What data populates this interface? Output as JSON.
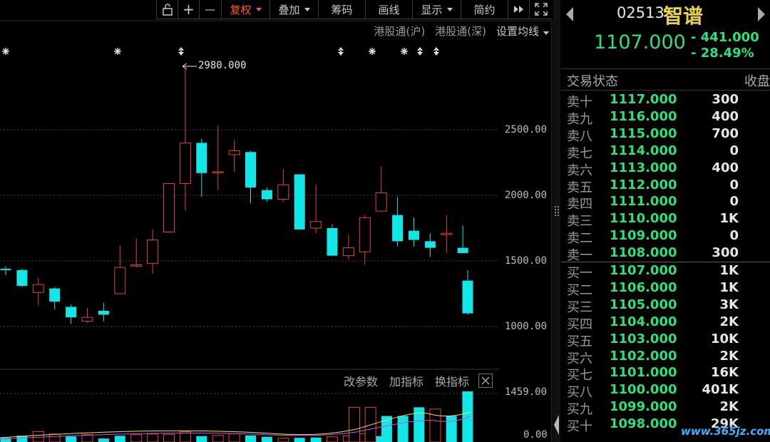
{
  "toolbar": {
    "lock_icon": "lock-icon",
    "plus": "+",
    "minus": "—",
    "fuquan": "复权",
    "diejia": "叠加",
    "chouma": "筹码",
    "huaxian": "画线",
    "xianshi": "显示",
    "jianyue": "简约"
  },
  "subbar": {
    "hk_sh": "港股通(沪)",
    "hk_sz": "港股通(深)",
    "ma_setting": "设置均线"
  },
  "chart": {
    "high_label": "2980.000",
    "y_labels": [
      "2500.00",
      "2000.00",
      "1500.00",
      "1000.00"
    ],
    "vol_labels": [
      "1459.00",
      "0.00"
    ],
    "bottom_buttons": {
      "params": "改参数",
      "add": "加指标",
      "switch": "换指标"
    },
    "up_color": "#e0453a",
    "down_color": "#12e6e6"
  },
  "chart_data": {
    "type": "candlestick",
    "y_ticks": [
      2500,
      2000,
      1500,
      1000
    ],
    "max_marked": 2980,
    "candles": [
      {
        "o": 1440,
        "h": 1460,
        "l": 1390,
        "c": 1430
      },
      {
        "o": 1430,
        "h": 1440,
        "l": 1300,
        "c": 1310
      },
      {
        "o": 1260,
        "h": 1370,
        "l": 1160,
        "c": 1320
      },
      {
        "o": 1290,
        "h": 1300,
        "l": 1130,
        "c": 1190
      },
      {
        "o": 1150,
        "h": 1170,
        "l": 1020,
        "c": 1070
      },
      {
        "o": 1040,
        "h": 1140,
        "l": 1030,
        "c": 1070
      },
      {
        "o": 1120,
        "h": 1180,
        "l": 1040,
        "c": 1090
      },
      {
        "o": 1250,
        "h": 1620,
        "l": 1250,
        "c": 1450
      },
      {
        "o": 1460,
        "h": 1670,
        "l": 1450,
        "c": 1470
      },
      {
        "o": 1480,
        "h": 1740,
        "l": 1400,
        "c": 1660
      },
      {
        "o": 1720,
        "h": 2080,
        "l": 1720,
        "c": 2090
      },
      {
        "o": 2090,
        "h": 2980,
        "l": 1880,
        "c": 2400
      },
      {
        "o": 2400,
        "h": 2430,
        "l": 1990,
        "c": 2170
      },
      {
        "o": 2180,
        "h": 2530,
        "l": 2040,
        "c": 2180
      },
      {
        "o": 2310,
        "h": 2420,
        "l": 2180,
        "c": 2340
      },
      {
        "o": 2330,
        "h": 2340,
        "l": 1940,
        "c": 2060
      },
      {
        "o": 2040,
        "h": 2060,
        "l": 1950,
        "c": 1970
      },
      {
        "o": 1970,
        "h": 2200,
        "l": 1950,
        "c": 2080
      },
      {
        "o": 2160,
        "h": 2160,
        "l": 1740,
        "c": 1740
      },
      {
        "o": 1750,
        "h": 2080,
        "l": 1710,
        "c": 1800
      },
      {
        "o": 1750,
        "h": 1780,
        "l": 1540,
        "c": 1540
      },
      {
        "o": 1540,
        "h": 1700,
        "l": 1510,
        "c": 1600
      },
      {
        "o": 1570,
        "h": 1850,
        "l": 1470,
        "c": 1830
      },
      {
        "o": 1880,
        "h": 2220,
        "l": 1880,
        "c": 2020
      },
      {
        "o": 1850,
        "h": 1990,
        "l": 1610,
        "c": 1650
      },
      {
        "o": 1730,
        "h": 1830,
        "l": 1610,
        "c": 1660
      },
      {
        "o": 1650,
        "h": 1710,
        "l": 1530,
        "c": 1600
      },
      {
        "o": 1700,
        "h": 1850,
        "l": 1560,
        "c": 1710
      },
      {
        "o": 1600,
        "h": 1770,
        "l": 1560,
        "c": 1560
      },
      {
        "o": 1350,
        "h": 1430,
        "l": 1090,
        "c": 1100
      }
    ],
    "volumes": [
      120,
      180,
      300,
      230,
      160,
      220,
      100,
      180,
      210,
      230,
      220,
      300,
      170,
      190,
      240,
      190,
      150,
      110,
      120,
      130,
      150,
      180,
      240,
      170,
      1000,
      1000,
      750,
      750,
      1000,
      950,
      750,
      1459
    ],
    "volume_colors": [
      "d",
      "d",
      "u",
      "u",
      "d",
      "u",
      "d",
      "d",
      "u",
      "u",
      "u",
      "u",
      "d",
      "u",
      "u",
      "d",
      "d",
      "u",
      "d",
      "d",
      "u",
      "u",
      "u",
      "d",
      "u",
      "u",
      "d",
      "d",
      "d",
      "u",
      "d",
      "d"
    ]
  },
  "panel": {
    "code": "02513",
    "name": "智谱",
    "price": "1107.000",
    "change": "- 441.000",
    "change_pct": "- 28.49%",
    "status_label": "交易状态",
    "status_right": "收盘"
  },
  "orderbook": {
    "asks": [
      {
        "label": "卖十",
        "price": "1117.000",
        "vol": "300"
      },
      {
        "label": "卖九",
        "price": "1116.000",
        "vol": "400"
      },
      {
        "label": "卖八",
        "price": "1115.000",
        "vol": "700"
      },
      {
        "label": "卖七",
        "price": "1114.000",
        "vol": "0"
      },
      {
        "label": "卖六",
        "price": "1113.000",
        "vol": "400"
      },
      {
        "label": "卖五",
        "price": "1112.000",
        "vol": "0"
      },
      {
        "label": "卖四",
        "price": "1111.000",
        "vol": "0"
      },
      {
        "label": "卖三",
        "price": "1110.000",
        "vol": "1K"
      },
      {
        "label": "卖二",
        "price": "1109.000",
        "vol": "0"
      },
      {
        "label": "卖一",
        "price": "1108.000",
        "vol": "300"
      }
    ],
    "bids": [
      {
        "label": "买一",
        "price": "1107.000",
        "vol": "1K"
      },
      {
        "label": "买二",
        "price": "1106.000",
        "vol": "1K"
      },
      {
        "label": "买三",
        "price": "1105.000",
        "vol": "3K"
      },
      {
        "label": "买四",
        "price": "1104.000",
        "vol": "2K"
      },
      {
        "label": "买五",
        "price": "1103.000",
        "vol": "10K"
      },
      {
        "label": "买六",
        "price": "1102.000",
        "vol": "2K"
      },
      {
        "label": "买七",
        "price": "1101.000",
        "vol": "16K"
      },
      {
        "label": "买八",
        "price": "1100.000",
        "vol": "401K"
      },
      {
        "label": "买九",
        "price": "1099.000",
        "vol": "2K"
      },
      {
        "label": "买十",
        "price": "1098.000",
        "vol": "29K"
      }
    ]
  },
  "watermark": "www.365jz.com"
}
